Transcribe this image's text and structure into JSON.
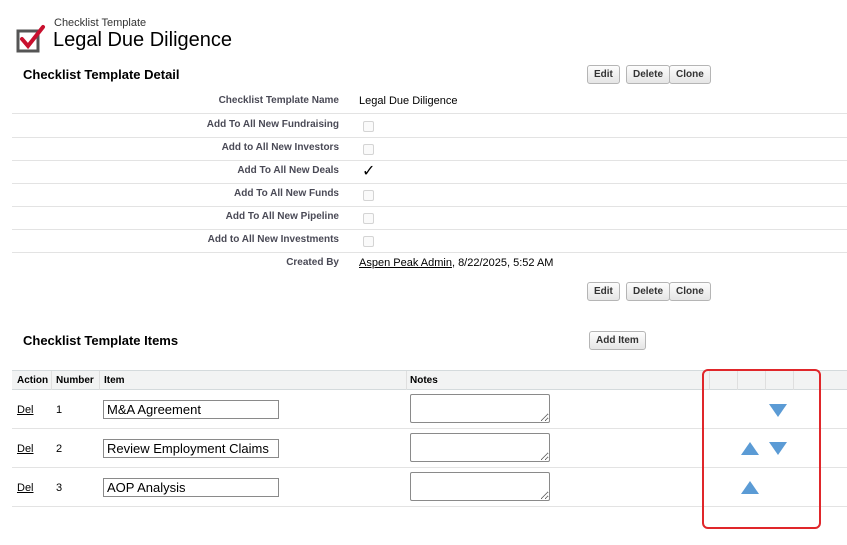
{
  "header": {
    "subtitle": "Checklist Template",
    "title": "Legal Due Diligence",
    "icon": "checklist-icon"
  },
  "detail": {
    "section_title": "Checklist Template Detail",
    "buttons": {
      "edit": "Edit",
      "delete": "Delete",
      "clone": "Clone"
    },
    "fields": [
      {
        "label": "Checklist Template Name",
        "value": "Legal Due Diligence"
      },
      {
        "label": "Add To All New Fundraising",
        "checked": false
      },
      {
        "label": "Add to All New Investors",
        "checked": false
      },
      {
        "label": "Add To All New Deals",
        "checked": true,
        "check_glyph": "✓"
      },
      {
        "label": "Add To All New Funds",
        "checked": false
      },
      {
        "label": "Add To All New Pipeline",
        "checked": false
      },
      {
        "label": "Add to All New Investments",
        "checked": false
      },
      {
        "label": "Created By",
        "user": "Aspen Peak Admin",
        "date": ", 8/22/2025, 5:52 AM"
      }
    ]
  },
  "items_section": {
    "title": "Checklist Template Items",
    "add_button": "Add Item",
    "columns": [
      "Action",
      "Number",
      "Item",
      "Notes"
    ],
    "rows": [
      {
        "action": "Del",
        "number": "1",
        "item": "M&A Agreement",
        "notes": "",
        "move_up": false,
        "move_down": true
      },
      {
        "action": "Del",
        "number": "2",
        "item": "Review Employment Claims",
        "notes": "",
        "move_up": true,
        "move_down": true
      },
      {
        "action": "Del",
        "number": "3",
        "item": "AOP Analysis",
        "notes": "",
        "move_up": true,
        "move_down": false
      }
    ]
  },
  "colors": {
    "arrow": "#5b9bd5",
    "highlight": "#e0262a",
    "check_red": "#c8102e"
  }
}
